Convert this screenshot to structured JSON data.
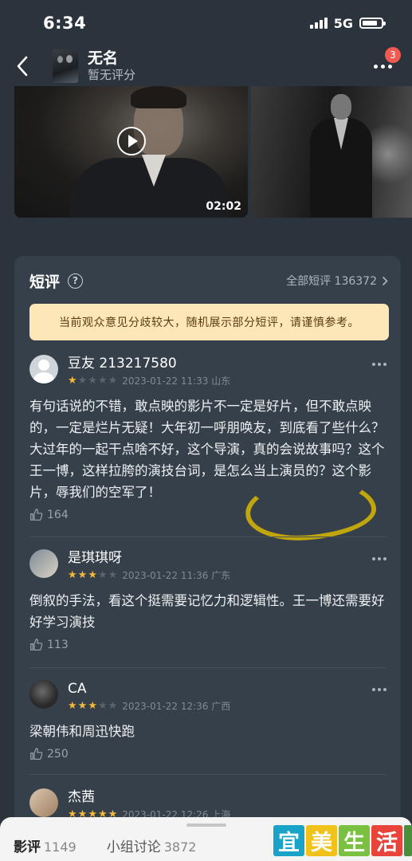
{
  "status_bar": {
    "time": "6:34",
    "network": "5G"
  },
  "header": {
    "title": "无名",
    "subtitle": "暂无评分",
    "notification_count": "3"
  },
  "media": {
    "duration": "02:02"
  },
  "reviews_section": {
    "title": "短评",
    "all_label": "全部短评 136372",
    "notice": "当前观众意见分歧较大，随机展示部分短评，请谨慎参考。",
    "items": [
      {
        "user": "豆友 213217580",
        "rating": 1,
        "meta": "2023-01-22 11:33 山东",
        "text": "有句话说的不错，敢点映的影片不一定是好片，但不敢点映的，一定是烂片无疑！大年初一呼朋唤友，到底看了些什么？大过年的一起干点啥不好，这个导演，真的会说故事吗？这个王一博，这样拉胯的演技台词，是怎么当上演员的？这个影片，辱我们的空军了！",
        "likes": "164"
      },
      {
        "user": "是琪琪呀",
        "rating": 3,
        "meta": "2023-01-22 11:36 广东",
        "text": "倒叙的手法，看这个挺需要记忆力和逻辑性。王一博还需要好好学习演技",
        "likes": "113"
      },
      {
        "user": "CA",
        "rating": 3,
        "meta": "2023-01-22 12:36 广西",
        "text": "梁朝伟和周迅快跑",
        "likes": "250"
      },
      {
        "user": "杰茜",
        "rating": 5,
        "meta": "2023-01-22 12:26 上海",
        "text": "",
        "likes": ""
      }
    ]
  },
  "bottom_tabs": [
    {
      "label": "影评",
      "count": "1149"
    },
    {
      "label": "小组讨论",
      "count": "3872"
    }
  ],
  "watermark": [
    "宜",
    "美",
    "生",
    "活"
  ],
  "colors": {
    "background": "#2b343d",
    "card": "#36404a",
    "notice_bg": "#fde6b8",
    "star_on": "#f5b93a",
    "badge": "#f05a50"
  }
}
